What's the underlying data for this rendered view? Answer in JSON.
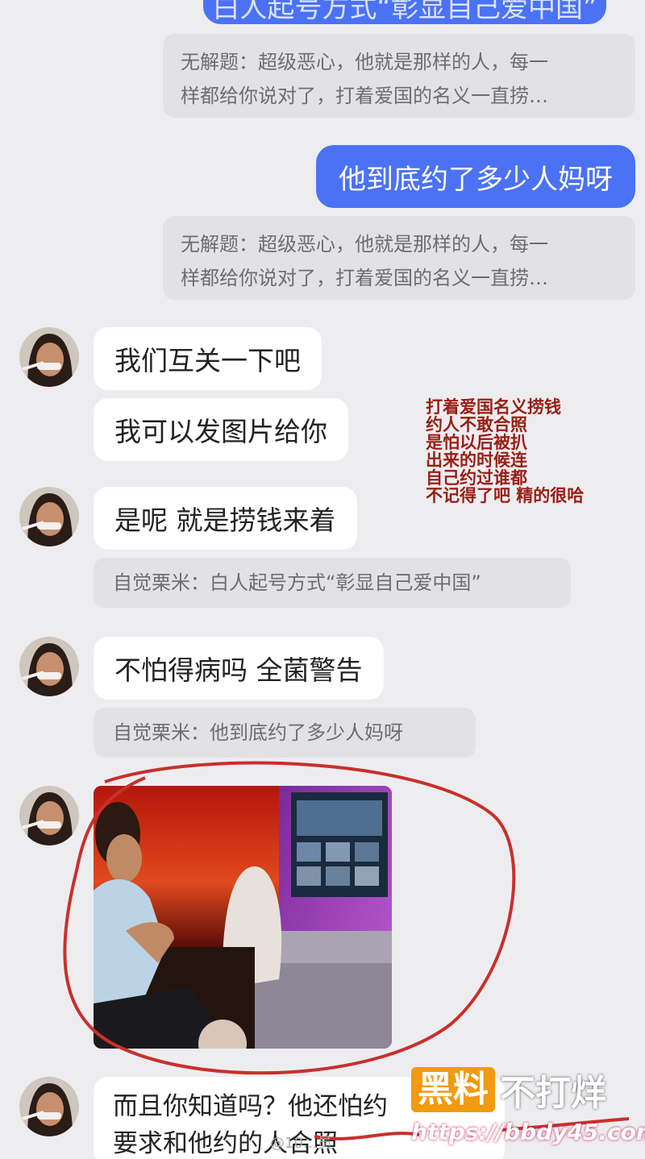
{
  "messages": {
    "top_partial_sent": "白人起号方式“彰显自己爱中国”",
    "quote1": {
      "line1": "无解题：超级恶心，他就是那样的人，每一",
      "line2": "样都给你说对了，打着爱国的名义一直捞…"
    },
    "sent1": "他到底约了多少人妈呀",
    "quote2": {
      "line1": "无解题：超级恶心，他就是那样的人，每一",
      "line2": "样都给你说对了，打着爱国的名义一直捞…"
    },
    "recv1": "我们互关一下吧",
    "recv2": "我可以发图片给你",
    "recv3": "是呢 就是捞钱来着",
    "quote3": "自觉栗米：白人起号方式“彰显自己爱中国”",
    "recv4": "不怕得病吗 全菌警告",
    "quote4": "自觉栗米：他到底约了多少人妈呀",
    "last": {
      "line1": "而且你知道吗？他还怕约",
      "line2": "要求和他约的人合照"
    }
  },
  "annotation": {
    "lines": [
      "打着爱国名义捞钱",
      "约人不敢合照",
      "是怕以后被扒",
      "出来的时候连",
      "自己约过谁都",
      "不记得了吧 精的很哈"
    ]
  },
  "watermark": {
    "box": "黑料",
    "text": "不打烊",
    "url": "https://bbdy45.com",
    "weibo": "@10…员"
  },
  "colors": {
    "sent_bubble": "#4b72f5",
    "annotation": "#9a1e14",
    "circle": "#c9302c"
  }
}
